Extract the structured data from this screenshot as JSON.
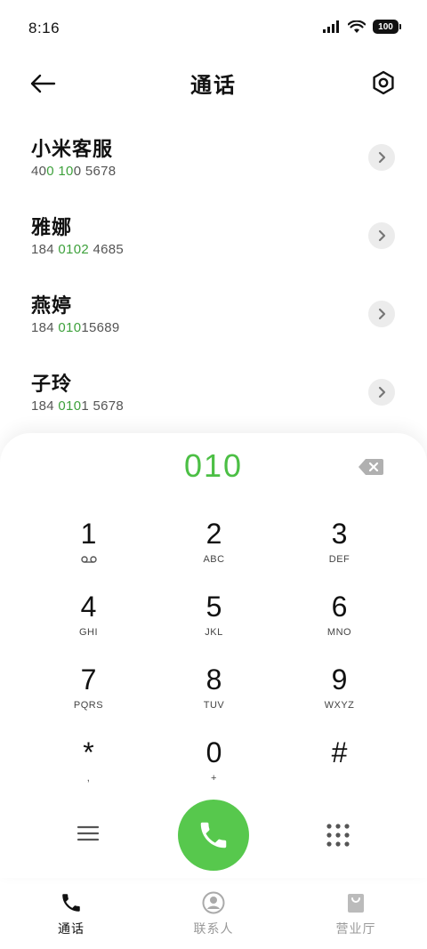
{
  "status_bar": {
    "time": "8:16",
    "battery": "100"
  },
  "header": {
    "title": "通话"
  },
  "results": [
    {
      "name": "小米客服",
      "number_pre": "40",
      "number_hl": "0 10",
      "number_post": "0 5678"
    },
    {
      "name": "雅娜",
      "number_pre": "184 ",
      "number_hl": "0102",
      "number_post": " 4685"
    },
    {
      "name": "燕婷",
      "number_pre": "184 ",
      "number_hl": "010",
      "number_post": "15689"
    },
    {
      "name": "子玲",
      "number_pre": "184 ",
      "number_hl": "010",
      "number_post": "1 5678"
    }
  ],
  "dialer": {
    "input_value": "010",
    "keys": [
      {
        "digit": "1",
        "letters": ""
      },
      {
        "digit": "2",
        "letters": "ABC"
      },
      {
        "digit": "3",
        "letters": "DEF"
      },
      {
        "digit": "4",
        "letters": "GHI"
      },
      {
        "digit": "5",
        "letters": "JKL"
      },
      {
        "digit": "6",
        "letters": "MNO"
      },
      {
        "digit": "7",
        "letters": "PQRS"
      },
      {
        "digit": "8",
        "letters": "TUV"
      },
      {
        "digit": "9",
        "letters": "WXYZ"
      },
      {
        "digit": "*",
        "letters": ","
      },
      {
        "digit": "0",
        "letters": "+"
      },
      {
        "digit": "#",
        "letters": ""
      }
    ]
  },
  "bottom_nav": [
    {
      "label": "通话",
      "icon": "phone-icon",
      "active": true
    },
    {
      "label": "联系人",
      "icon": "contact-icon",
      "active": false
    },
    {
      "label": "营业厅",
      "icon": "shop-bag-icon",
      "active": false
    }
  ],
  "colors": {
    "accent": "#4cbf45",
    "call_button": "#57c84d",
    "highlight": "#3ea13c"
  }
}
